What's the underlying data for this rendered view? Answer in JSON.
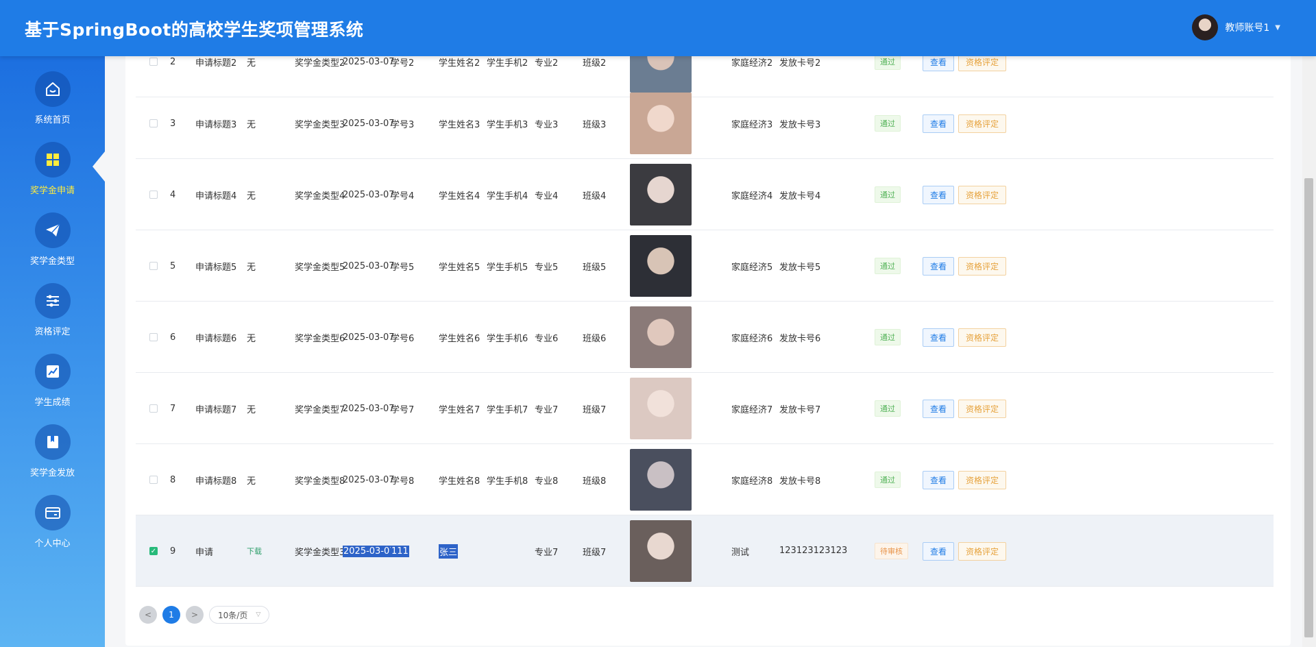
{
  "header": {
    "title": "基于SpringBoot的高校学生奖项管理系统",
    "username": "教师账号1",
    "bg_color": "#1f7ce6"
  },
  "sidebar": {
    "items": [
      {
        "label": "系统首页",
        "icon": "home-icon",
        "active": false
      },
      {
        "label": "奖学金申请",
        "icon": "grid-icon",
        "active": true
      },
      {
        "label": "奖学金类型",
        "icon": "paper-plane-icon",
        "active": false
      },
      {
        "label": "资格评定",
        "icon": "sliders-icon",
        "active": false
      },
      {
        "label": "学生成绩",
        "icon": "chart-icon",
        "active": false
      },
      {
        "label": "奖学金发放",
        "icon": "book-icon",
        "active": false
      },
      {
        "label": "个人中心",
        "icon": "card-icon",
        "active": false
      }
    ],
    "active_label_color": "#ffec3d"
  },
  "table": {
    "rows": [
      {
        "no": "2",
        "title": "申请标题2",
        "file": "无",
        "type": "奖学金类型2",
        "date": "2025-03-07",
        "sid": "学号2",
        "name": "学生姓名2",
        "phone": "学生手机2",
        "major": "专业2",
        "cls": "班级2",
        "family": "家庭经济2",
        "card": "发放卡号2",
        "status": "通过",
        "checked": false
      },
      {
        "no": "3",
        "title": "申请标题3",
        "file": "无",
        "type": "奖学金类型3",
        "date": "2025-03-07",
        "sid": "学号3",
        "name": "学生姓名3",
        "phone": "学生手机3",
        "major": "专业3",
        "cls": "班级3",
        "family": "家庭经济3",
        "card": "发放卡号3",
        "status": "通过",
        "checked": false
      },
      {
        "no": "4",
        "title": "申请标题4",
        "file": "无",
        "type": "奖学金类型4",
        "date": "2025-03-07",
        "sid": "学号4",
        "name": "学生姓名4",
        "phone": "学生手机4",
        "major": "专业4",
        "cls": "班级4",
        "family": "家庭经济4",
        "card": "发放卡号4",
        "status": "通过",
        "checked": false
      },
      {
        "no": "5",
        "title": "申请标题5",
        "file": "无",
        "type": "奖学金类型5",
        "date": "2025-03-07",
        "sid": "学号5",
        "name": "学生姓名5",
        "phone": "学生手机5",
        "major": "专业5",
        "cls": "班级5",
        "family": "家庭经济5",
        "card": "发放卡号5",
        "status": "通过",
        "checked": false
      },
      {
        "no": "6",
        "title": "申请标题6",
        "file": "无",
        "type": "奖学金类型6",
        "date": "2025-03-07",
        "sid": "学号6",
        "name": "学生姓名6",
        "phone": "学生手机6",
        "major": "专业6",
        "cls": "班级6",
        "family": "家庭经济6",
        "card": "发放卡号6",
        "status": "通过",
        "checked": false
      },
      {
        "no": "7",
        "title": "申请标题7",
        "file": "无",
        "type": "奖学金类型7",
        "date": "2025-03-07",
        "sid": "学号7",
        "name": "学生姓名7",
        "phone": "学生手机7",
        "major": "专业7",
        "cls": "班级7",
        "family": "家庭经济7",
        "card": "发放卡号7",
        "status": "通过",
        "checked": false
      },
      {
        "no": "8",
        "title": "申请标题8",
        "file": "无",
        "type": "奖学金类型8",
        "date": "2025-03-07",
        "sid": "学号8",
        "name": "学生姓名8",
        "phone": "学生手机8",
        "major": "专业8",
        "cls": "班级8",
        "family": "家庭经济8",
        "card": "发放卡号8",
        "status": "通过",
        "checked": false
      },
      {
        "no": "9",
        "title": "申请",
        "file": "下载",
        "type": "奖学金类型3",
        "date": "2025-03-07",
        "sid": "111",
        "name": "张三",
        "phone": "",
        "major": "专业7",
        "cls": "班级7",
        "family": "测试",
        "card": "123123123123",
        "status": "待审核",
        "checked": true
      }
    ],
    "view_label": "查看",
    "eval_label": "资格评定"
  },
  "pagination": {
    "prev": "<",
    "current": "1",
    "next": ">",
    "page_size": "10条/页"
  }
}
